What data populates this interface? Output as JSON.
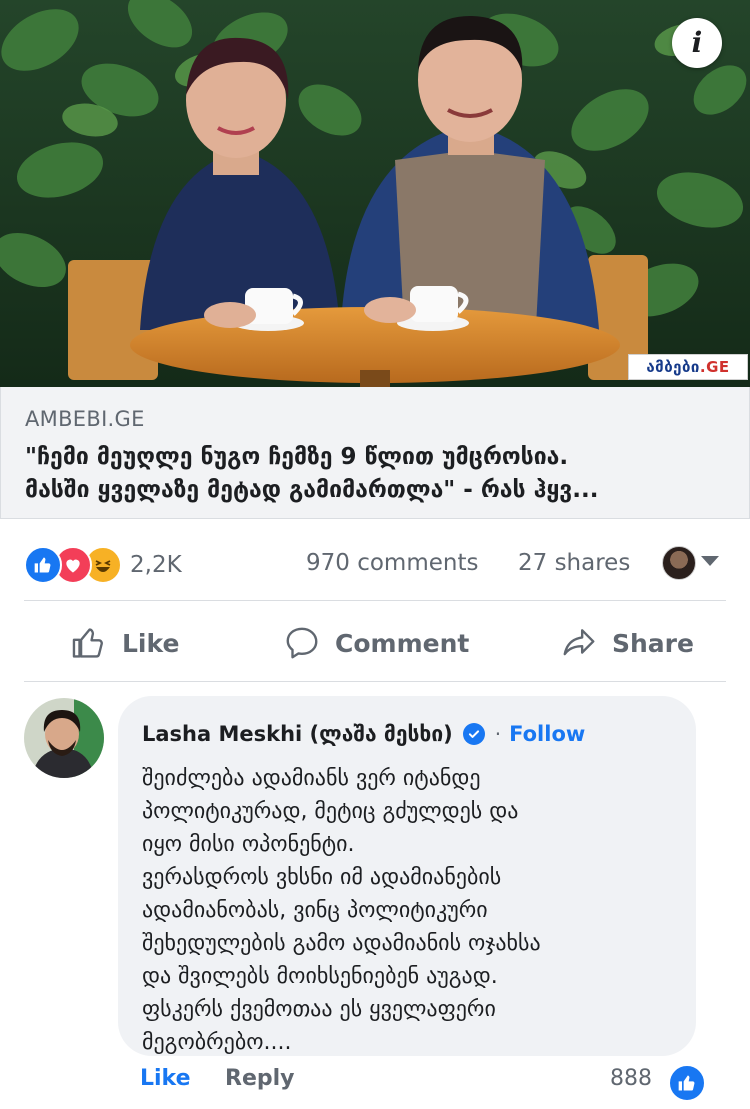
{
  "post": {
    "image": {
      "description_icon": "info-icon",
      "watermark_part1": "ამბები",
      "watermark_part2": ".GE"
    },
    "link": {
      "domain": "AMBEBI.GE",
      "title_line1": "\"ჩემი მეუღლე ნუგო ჩემზე 9 წლით უმცროსია.",
      "title_line2": "მასში ყველაზე მეტად გამიმართლა\" - რას ჰყვ..."
    },
    "stats": {
      "reaction_icons": [
        "like-icon",
        "love-icon",
        "haha-icon"
      ],
      "reaction_count": "2,2K",
      "comments": "970 comments",
      "shares": "27 shares"
    },
    "actions": {
      "like": "Like",
      "comment": "Comment",
      "share": "Share"
    }
  },
  "comment": {
    "author": "Lasha Meskhi (ლაშა მესხი)",
    "separator": "·",
    "follow": "Follow",
    "lines": [
      "შეიძლება ადამიანს ვერ იტანდე",
      "პოლიტიკურად, მეტიც გძულდეს და",
      "იყო მისი ოპონენტი.",
      "ვერასდროს ვხსნი იმ ადამიანების",
      "ადამიანობას, ვინც პოლიტიკური",
      "შეხედულების გამო ადამიანის ოჯახსა",
      "და შვილებს მოიხსენიებენ აუგად.",
      "ფსკერს ქვემოთაა ეს ყველაფერი",
      "მეგობრებო...."
    ],
    "footer": {
      "like": "Like",
      "reply": "Reply",
      "like_count": "888"
    }
  },
  "colors": {
    "accent": "#1877f2",
    "secondary_text": "#606770",
    "bubble_bg": "#f0f2f5",
    "link_bg": "#f2f3f5"
  }
}
